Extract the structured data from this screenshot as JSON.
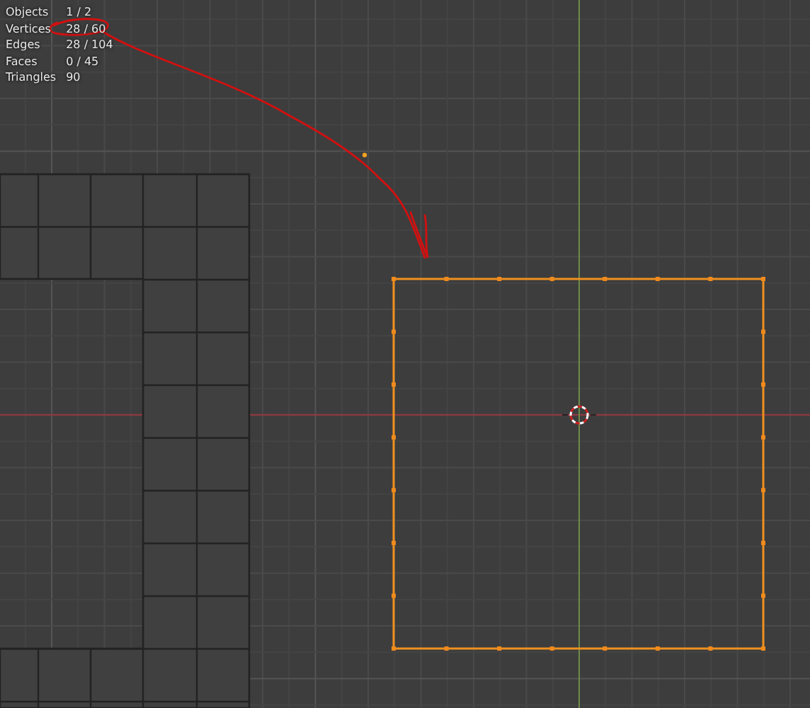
{
  "stats": [
    {
      "label": "Objects",
      "value": "1 / 2"
    },
    {
      "label": "Vertices",
      "value": "28 / 60"
    },
    {
      "label": "Edges",
      "value": "28 / 104"
    },
    {
      "label": "Faces",
      "value": "0 / 45"
    },
    {
      "label": "Triangles",
      "value": "90"
    }
  ]
}
